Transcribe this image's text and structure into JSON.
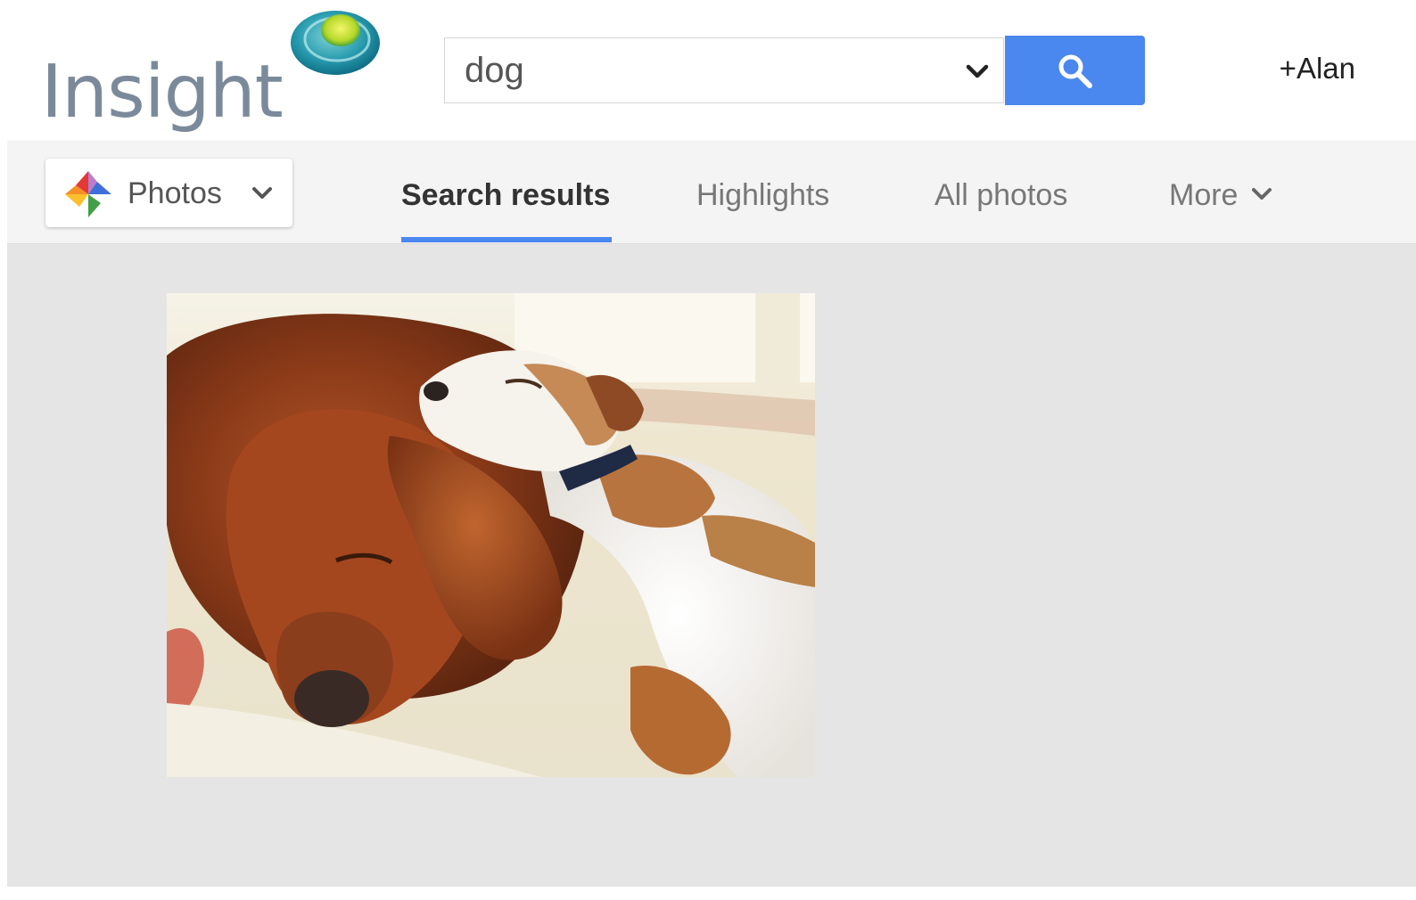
{
  "header": {
    "logo_text": "Insight",
    "search": {
      "value": "dog"
    },
    "user_label": "+Alan"
  },
  "tabbar": {
    "product_menu_label": "Photos",
    "tabs": [
      {
        "label": "Search results",
        "active": true
      },
      {
        "label": "Highlights",
        "active": false
      },
      {
        "label": "All photos",
        "active": false
      },
      {
        "label": "More",
        "active": false
      }
    ]
  },
  "results": {
    "photos": [
      {
        "subject": "two dogs sleeping on a rug"
      }
    ]
  },
  "colors": {
    "accent_blue": "#4a87ee",
    "content_bg": "#e5e5e5",
    "tabbar_bg": "#f4f4f4",
    "logo_gray": "#7b8a9b"
  },
  "icons": {
    "logo_mark": "teal-orb-icon",
    "search_button": "search-icon",
    "search_dropdown": "chevron-down-icon",
    "product_menu": "pinwheel-icon",
    "more_tab": "chevron-down-icon"
  }
}
